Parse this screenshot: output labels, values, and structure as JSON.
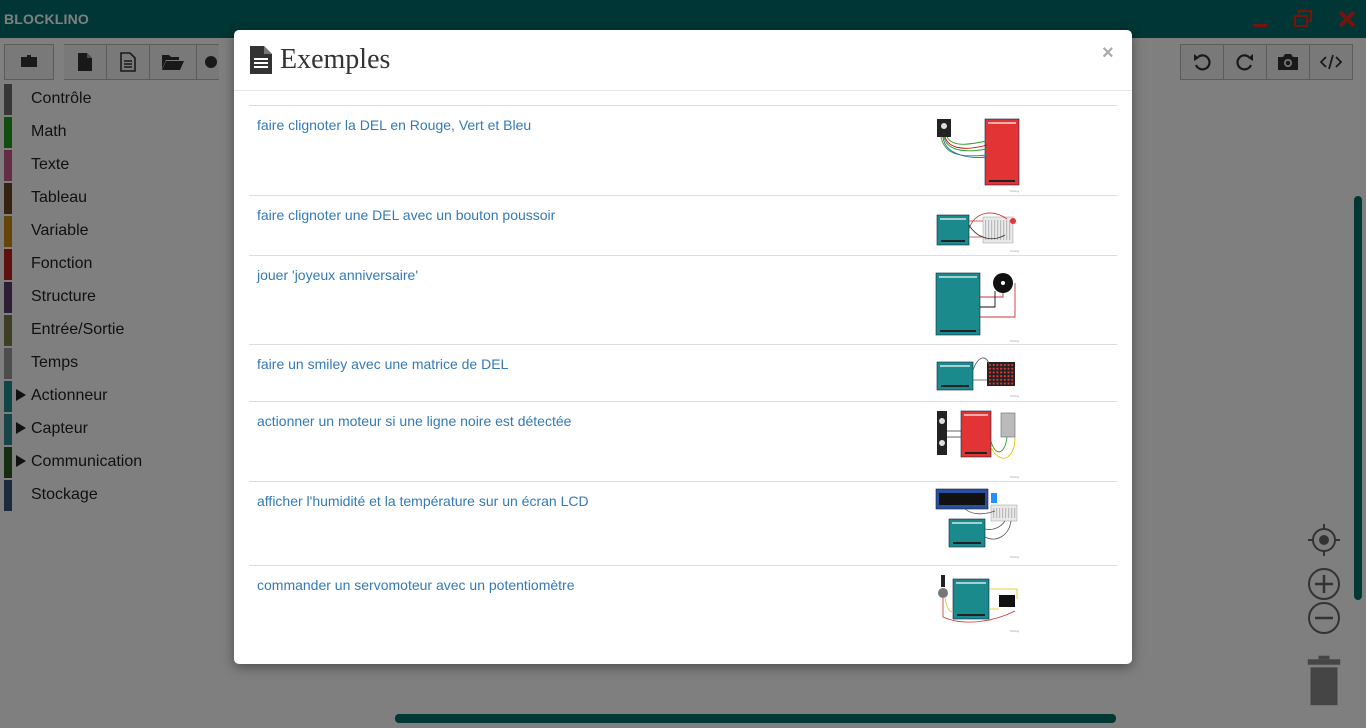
{
  "app": {
    "title": "BLOCKLINO"
  },
  "window_controls": {
    "icons": [
      "minimize-icon",
      "restore-icon",
      "close-icon"
    ],
    "accent": "#e8291c"
  },
  "toolbar_left": {
    "icons": [
      "puzzle-icon",
      "new-file-icon",
      "file-text-icon",
      "open-folder-icon",
      "cloud-icon"
    ]
  },
  "toolbar_right": {
    "icons": [
      "undo-icon",
      "redo-icon",
      "camera-icon",
      "code-icon"
    ]
  },
  "categories": [
    {
      "label": "Contrôle",
      "color": "#6d6d6d",
      "expandable": false
    },
    {
      "label": "Math",
      "color": "#1e9d1e",
      "expandable": false
    },
    {
      "label": "Texte",
      "color": "#c65b8a",
      "expandable": false
    },
    {
      "label": "Tableau",
      "color": "#6b4423",
      "expandable": false
    },
    {
      "label": "Variable",
      "color": "#cc8a12",
      "expandable": false
    },
    {
      "label": "Fonction",
      "color": "#c11e1e",
      "expandable": false
    },
    {
      "label": "Structure",
      "color": "#5b3b6b",
      "expandable": false
    },
    {
      "label": "Entrée/Sortie",
      "color": "#7c7d4c",
      "expandable": false
    },
    {
      "label": "Temps",
      "color": "#9a9a9a",
      "expandable": false
    },
    {
      "label": "Actionneur",
      "color": "#1f8a8f",
      "expandable": true
    },
    {
      "label": "Capteur",
      "color": "#2f8a8f",
      "expandable": true
    },
    {
      "label": "Communication",
      "color": "#285b25",
      "expandable": true
    },
    {
      "label": "Stockage",
      "color": "#3b5576",
      "expandable": false
    }
  ],
  "modal": {
    "title": "Exemples",
    "title_icon": "file-text-icon",
    "close_label": "×",
    "examples": [
      {
        "label": "faire clignoter la DEL en Rouge, Vert et Bleu",
        "thumb": "rgb-led-red-board"
      },
      {
        "label": "faire clignoter une DEL avec un bouton poussoir",
        "thumb": "led-button-breadboard"
      },
      {
        "label": "jouer 'joyeux anniversaire'",
        "thumb": "arduino-buzzer"
      },
      {
        "label": "faire un smiley avec une matrice de DEL",
        "thumb": "led-matrix"
      },
      {
        "label": "actionner un moteur si une ligne noire est détectée",
        "thumb": "line-sensor-motor"
      },
      {
        "label": "afficher l'humidité et la température sur un écran LCD",
        "thumb": "lcd-dht"
      },
      {
        "label": "commander un servomoteur avec un potentiomètre",
        "thumb": "servo-potentiometer"
      }
    ],
    "thumb_caption": "fritzing"
  },
  "workspace": {
    "controls": [
      "recenter-icon",
      "zoom-in-icon",
      "zoom-out-icon",
      "trash-icon"
    ]
  }
}
